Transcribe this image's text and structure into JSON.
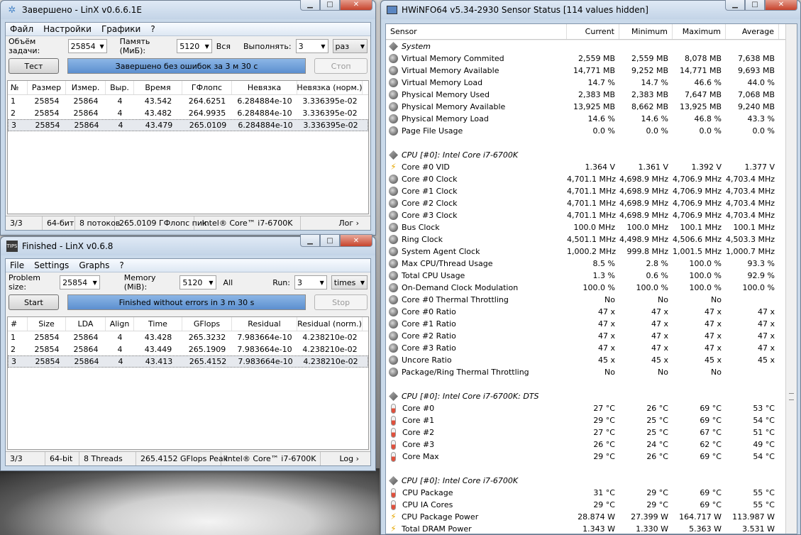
{
  "linx_ru": {
    "title": "Завершено - LinX v0.6.6.1E",
    "menu": [
      "Файл",
      "Настройки",
      "Графики",
      "?"
    ],
    "task_label": "Объём задачи:",
    "task_value": "25854",
    "mem_label": "Память (МиБ):",
    "mem_value": "5120",
    "mem_all": "Вся",
    "run_label": "Выполнять:",
    "run_value": "3",
    "run_unit": "раз",
    "start_btn": "Тест",
    "stop_btn": "Стоп",
    "progress_text": "Завершено без ошибок за 3 м 30 с",
    "columns": [
      "№",
      "Размер",
      "Измер.",
      "Выр.",
      "Время",
      "ГФлопс",
      "Невязка",
      "Невязка (норм.)"
    ],
    "rows": [
      [
        "1",
        "25854",
        "25864",
        "4",
        "43.542",
        "264.6251",
        "6.284884e-10",
        "3.336395e-02"
      ],
      [
        "2",
        "25854",
        "25864",
        "4",
        "43.482",
        "264.9935",
        "6.284884e-10",
        "3.336395e-02"
      ],
      [
        "3",
        "25854",
        "25864",
        "4",
        "43.479",
        "265.0109",
        "6.284884e-10",
        "3.336395e-02"
      ]
    ],
    "status": [
      "3/3",
      "64-бит",
      "8 потоков",
      "265.0109 ГФлопс пик",
      "Intel® Core™ i7-6700K",
      "Лог ›"
    ]
  },
  "linx_en": {
    "title": "Finished - LinX v0.6.8",
    "menu": [
      "File",
      "Settings",
      "Graphs",
      "?"
    ],
    "task_label": "Problem size:",
    "task_value": "25854",
    "mem_label": "Memory (MiB):",
    "mem_value": "5120",
    "mem_all": "All",
    "run_label": "Run:",
    "run_value": "3",
    "run_unit": "times",
    "start_btn": "Start",
    "stop_btn": "Stop",
    "progress_text": "Finished without errors in 3 m 30 s",
    "columns": [
      "#",
      "Size",
      "LDA",
      "Align",
      "Time",
      "GFlops",
      "Residual",
      "Residual (norm.)"
    ],
    "rows": [
      [
        "1",
        "25854",
        "25864",
        "4",
        "43.428",
        "265.3232",
        "7.983664e-10",
        "4.238210e-02"
      ],
      [
        "2",
        "25854",
        "25864",
        "4",
        "43.449",
        "265.1909",
        "7.983664e-10",
        "4.238210e-02"
      ],
      [
        "3",
        "25854",
        "25864",
        "4",
        "43.413",
        "265.4152",
        "7.983664e-10",
        "4.238210e-02"
      ]
    ],
    "status": [
      "3/3",
      "64-bit",
      "8 Threads",
      "265.4152 GFlops Peak",
      "Intel® Core™ i7-6700K",
      "Log ›"
    ]
  },
  "hwinfo": {
    "title": "HWiNFO64 v5.34-2930 Sensor Status [114 values hidden]",
    "columns": [
      "Sensor",
      "Current",
      "Minimum",
      "Maximum",
      "Average"
    ],
    "rows": [
      {
        "icon": "chip",
        "group": true,
        "name": "System"
      },
      {
        "icon": "circle",
        "name": "Virtual Memory Commited",
        "v": [
          "2,559 MB",
          "2,559 MB",
          "8,078 MB",
          "7,638 MB"
        ]
      },
      {
        "icon": "circle",
        "name": "Virtual Memory Available",
        "v": [
          "14,771 MB",
          "9,252 MB",
          "14,771 MB",
          "9,693 MB"
        ]
      },
      {
        "icon": "circle",
        "name": "Virtual Memory Load",
        "v": [
          "14.7 %",
          "14.7 %",
          "46.6 %",
          "44.0 %"
        ]
      },
      {
        "icon": "circle",
        "name": "Physical Memory Used",
        "v": [
          "2,383 MB",
          "2,383 MB",
          "7,647 MB",
          "7,068 MB"
        ]
      },
      {
        "icon": "circle",
        "name": "Physical Memory Available",
        "v": [
          "13,925 MB",
          "8,662 MB",
          "13,925 MB",
          "9,240 MB"
        ]
      },
      {
        "icon": "circle",
        "name": "Physical Memory Load",
        "v": [
          "14.6 %",
          "14.6 %",
          "46.8 %",
          "43.3 %"
        ]
      },
      {
        "icon": "circle",
        "name": "Page File Usage",
        "v": [
          "0.0 %",
          "0.0 %",
          "0.0 %",
          "0.0 %"
        ]
      },
      {
        "blank": true
      },
      {
        "icon": "chip",
        "group": true,
        "name": "CPU [#0]: Intel Core i7-6700K"
      },
      {
        "icon": "bolt",
        "name": "Core #0 VID",
        "v": [
          "1.364 V",
          "1.361 V",
          "1.392 V",
          "1.377 V"
        ]
      },
      {
        "icon": "circle",
        "name": "Core #0 Clock",
        "v": [
          "4,701.1 MHz",
          "4,698.9 MHz",
          "4,706.9 MHz",
          "4,703.4 MHz"
        ]
      },
      {
        "icon": "circle",
        "name": "Core #1 Clock",
        "v": [
          "4,701.1 MHz",
          "4,698.9 MHz",
          "4,706.9 MHz",
          "4,703.4 MHz"
        ]
      },
      {
        "icon": "circle",
        "name": "Core #2 Clock",
        "v": [
          "4,701.1 MHz",
          "4,698.9 MHz",
          "4,706.9 MHz",
          "4,703.4 MHz"
        ]
      },
      {
        "icon": "circle",
        "name": "Core #3 Clock",
        "v": [
          "4,701.1 MHz",
          "4,698.9 MHz",
          "4,706.9 MHz",
          "4,703.4 MHz"
        ]
      },
      {
        "icon": "circle",
        "name": "Bus Clock",
        "v": [
          "100.0 MHz",
          "100.0 MHz",
          "100.1 MHz",
          "100.1 MHz"
        ]
      },
      {
        "icon": "circle",
        "name": "Ring Clock",
        "v": [
          "4,501.1 MHz",
          "4,498.9 MHz",
          "4,506.6 MHz",
          "4,503.3 MHz"
        ]
      },
      {
        "icon": "circle",
        "name": "System Agent Clock",
        "v": [
          "1,000.2 MHz",
          "999.8 MHz",
          "1,001.5 MHz",
          "1,000.7 MHz"
        ]
      },
      {
        "icon": "circle",
        "name": "Max CPU/Thread Usage",
        "v": [
          "8.5 %",
          "2.8 %",
          "100.0 %",
          "93.3 %"
        ]
      },
      {
        "icon": "circle",
        "name": "Total CPU Usage",
        "v": [
          "1.3 %",
          "0.6 %",
          "100.0 %",
          "92.9 %"
        ]
      },
      {
        "icon": "circle",
        "name": "On-Demand Clock Modulation",
        "v": [
          "100.0 %",
          "100.0 %",
          "100.0 %",
          "100.0 %"
        ]
      },
      {
        "icon": "circle",
        "name": "Core #0 Thermal Throttling",
        "v": [
          "No",
          "No",
          "No",
          ""
        ]
      },
      {
        "icon": "circle",
        "name": "Core #0 Ratio",
        "v": [
          "47 x",
          "47 x",
          "47 x",
          "47 x"
        ]
      },
      {
        "icon": "circle",
        "name": "Core #1 Ratio",
        "v": [
          "47 x",
          "47 x",
          "47 x",
          "47 x"
        ]
      },
      {
        "icon": "circle",
        "name": "Core #2 Ratio",
        "v": [
          "47 x",
          "47 x",
          "47 x",
          "47 x"
        ]
      },
      {
        "icon": "circle",
        "name": "Core #3 Ratio",
        "v": [
          "47 x",
          "47 x",
          "47 x",
          "47 x"
        ]
      },
      {
        "icon": "circle",
        "name": "Uncore Ratio",
        "v": [
          "45 x",
          "45 x",
          "45 x",
          "45 x"
        ]
      },
      {
        "icon": "circle",
        "name": "Package/Ring Thermal Throttling",
        "v": [
          "No",
          "No",
          "No",
          ""
        ]
      },
      {
        "blank": true
      },
      {
        "icon": "chip",
        "group": true,
        "name": "CPU [#0]: Intel Core i7-6700K: DTS"
      },
      {
        "icon": "therm",
        "name": "Core #0",
        "v": [
          "27 °C",
          "26 °C",
          "69 °C",
          "53 °C"
        ]
      },
      {
        "icon": "therm",
        "name": "Core #1",
        "v": [
          "29 °C",
          "25 °C",
          "69 °C",
          "54 °C"
        ]
      },
      {
        "icon": "therm",
        "name": "Core #2",
        "v": [
          "27 °C",
          "25 °C",
          "67 °C",
          "51 °C"
        ]
      },
      {
        "icon": "therm",
        "name": "Core #3",
        "v": [
          "26 °C",
          "24 °C",
          "62 °C",
          "49 °C"
        ]
      },
      {
        "icon": "therm",
        "name": "Core Max",
        "v": [
          "29 °C",
          "26 °C",
          "69 °C",
          "54 °C"
        ]
      },
      {
        "blank": true
      },
      {
        "icon": "chip",
        "group": true,
        "name": "CPU [#0]: Intel Core i7-6700K"
      },
      {
        "icon": "therm",
        "name": "CPU Package",
        "v": [
          "31 °C",
          "29 °C",
          "69 °C",
          "55 °C"
        ]
      },
      {
        "icon": "therm",
        "name": "CPU IA Cores",
        "v": [
          "29 °C",
          "29 °C",
          "69 °C",
          "55 °C"
        ]
      },
      {
        "icon": "bolt",
        "name": "CPU Package Power",
        "v": [
          "28.874 W",
          "27.399 W",
          "164.717 W",
          "113.987 W"
        ]
      },
      {
        "icon": "bolt",
        "name": "Total DRAM Power",
        "v": [
          "1.343 W",
          "1.330 W",
          "5.363 W",
          "3.531 W"
        ]
      }
    ]
  }
}
